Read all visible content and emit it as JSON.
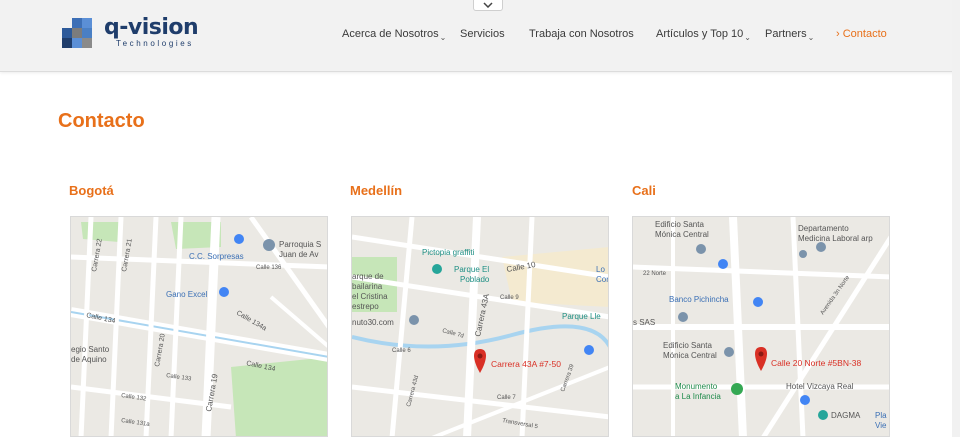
{
  "logo": {
    "brand": "q-vision",
    "tagline": "Technologies"
  },
  "nav": {
    "items": [
      {
        "label": "Acerca de Nosotros",
        "has_dropdown": true
      },
      {
        "label": "Servicios",
        "has_dropdown": false
      },
      {
        "label": "Trabaja con Nosotros",
        "has_dropdown": false
      },
      {
        "label": "Artículos y Top 10",
        "has_dropdown": true
      },
      {
        "label": "Partners",
        "has_dropdown": true
      },
      {
        "label": "Contacto",
        "has_dropdown": false,
        "active": true,
        "prefix": "›"
      }
    ],
    "chevron": "⌄"
  },
  "page": {
    "title": "Contacto"
  },
  "offices": [
    {
      "city": "Bogotá",
      "map": {
        "labels": [
          "C.C. Sorpresas",
          "Parroquia S",
          "Juan de Av",
          "Gano Excel",
          "Calle 134",
          "Calle 134",
          "Calle 134a",
          "Calle 136",
          "Carrera 22",
          "Carrera 21",
          "Carrera 20",
          "Carrera 19",
          "egio Santo",
          "de Aquino",
          "Calle 133",
          "Calle 132",
          "Calle 131a"
        ]
      }
    },
    {
      "city": "Medellín",
      "map": {
        "labels": [
          "Pictopia graffiti",
          "Parque El",
          "Poblado",
          "arque de",
          "bailarina",
          "el Cristina",
          "estrepo",
          "Calle 10",
          "Calle 9",
          "Parque Lle",
          "nuto30.com",
          "Carrera 43A",
          "Carrera 43A #7-50",
          "Calle 7",
          "Calle 6",
          "Transversal 5",
          "Carrera 39",
          "Lo",
          "Conter",
          "Calle 7d",
          "Carrera 43d"
        ]
      }
    },
    {
      "city": "Cali",
      "map": {
        "labels": [
          "Edificio Santa",
          "Mónica Central",
          "Departamento",
          "Medicina Laboral arp",
          "22 Norte",
          "Banco Pichincha",
          "Avenida 3n Norte",
          "s SAS",
          "Edificio Santa",
          "Mónica Central",
          "Calle 20 Norte #5BN-38",
          "Monumento",
          "a La Infancia",
          "Hotel Vizcaya Real",
          "DAGMA",
          "Pla",
          "Vie"
        ]
      }
    }
  ],
  "colors": {
    "accent": "#e8701a",
    "brand": "#1f3d6b",
    "pin": "#d93025"
  }
}
